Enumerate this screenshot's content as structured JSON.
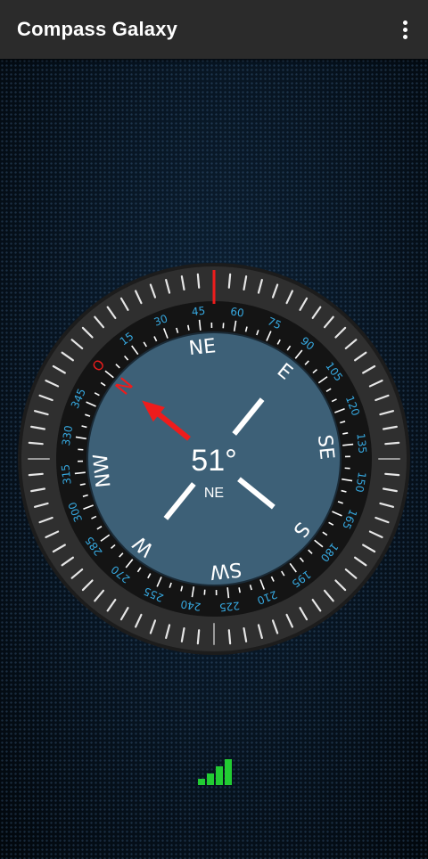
{
  "app_bar": {
    "title": "Compass Galaxy",
    "menu_icon": "more-vert-icon"
  },
  "compass": {
    "heading_degrees": 51,
    "heading_text": "51°",
    "direction_text": "NE",
    "north_label": "N",
    "north_marker": "O",
    "cardinal_labels": [
      "NE",
      "E",
      "SE",
      "S",
      "SW",
      "W",
      "NW"
    ],
    "degree_labels": [
      "15",
      "30",
      "45",
      "60",
      "75",
      "90",
      "105",
      "120",
      "135",
      "150",
      "165",
      "180",
      "195",
      "210",
      "225",
      "240",
      "255",
      "270",
      "285",
      "300",
      "315",
      "330",
      "345"
    ],
    "colors": {
      "dial_face": "#3d6077",
      "degree_text": "#36a9e1",
      "north_needle": "#ee1c1c",
      "bezel": "#2f2f2f",
      "ring": "#141414"
    }
  },
  "signal": {
    "icon": "signal-strength-icon",
    "bars_active": 4,
    "bars_total": 4,
    "color": "#22cc33"
  }
}
